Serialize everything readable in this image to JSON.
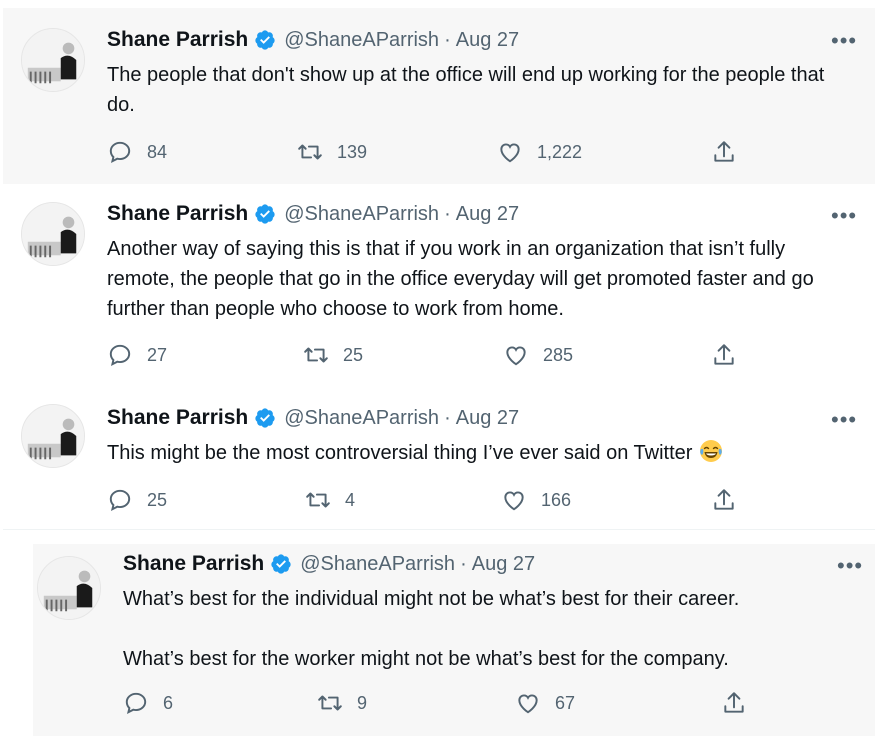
{
  "tweets": [
    {
      "author": "Shane Parrish",
      "handle": "@ShaneAParrish",
      "separator": "·",
      "date": "Aug 27",
      "paragraphs": [
        "The people that don't show up at the office will end up working for the people that do."
      ],
      "replies": "84",
      "retweets": "139",
      "likes": "1,222"
    },
    {
      "author": "Shane Parrish",
      "handle": "@ShaneAParrish",
      "separator": "·",
      "date": "Aug 27",
      "paragraphs": [
        "Another way of saying this is that if you work in an organization that isn’t fully remote, the people that go in the office everyday will get promoted faster and go further than people who choose to work from home."
      ],
      "replies": "27",
      "retweets": "25",
      "likes": "285"
    },
    {
      "author": "Shane Parrish",
      "handle": "@ShaneAParrish",
      "separator": "·",
      "date": "Aug 27",
      "paragraphs": [
        "This might be the most controversial thing I’ve ever said on Twitter"
      ],
      "emoji": "face-with-tears-of-joy",
      "replies": "25",
      "retweets": "4",
      "likes": "166"
    },
    {
      "author": "Shane Parrish",
      "handle": "@ShaneAParrish",
      "separator": "·",
      "date": "Aug 27",
      "paragraphs": [
        "What’s best for the individual might not be what’s best for their career.",
        "What’s best for the worker might not be what’s best for the company."
      ],
      "replies": "6",
      "retweets": "9",
      "likes": "67"
    }
  ],
  "icons": {
    "reply": "reply-icon",
    "retweet": "retweet-icon",
    "like": "heart-icon",
    "share": "share-icon",
    "more": "more-options-icon",
    "verified": "verified-badge-icon"
  },
  "more_label": "•••",
  "colors": {
    "verified_blue": "#1d9bf0",
    "text_primary": "#0f1419",
    "text_secondary": "#536471",
    "highlight_bg": "#f7f7f7",
    "thread_line": "#cfd9de"
  }
}
